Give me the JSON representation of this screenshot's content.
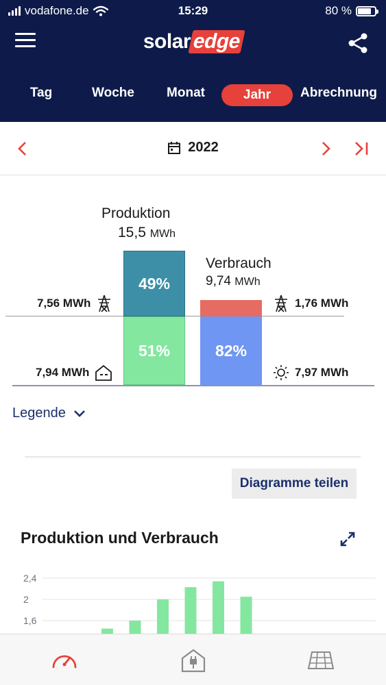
{
  "status_bar": {
    "carrier": "vodafone.de",
    "time": "15:29",
    "battery": "80 %",
    "battery_level": 0.8
  },
  "header": {
    "logo_part1": "solar",
    "logo_part2": "edge"
  },
  "tabs": [
    {
      "label": "Tag",
      "active": false
    },
    {
      "label": "Woche",
      "active": false
    },
    {
      "label": "Monat",
      "active": false
    },
    {
      "label": "Jahr",
      "active": true
    },
    {
      "label": "Abrechnung",
      "active": false
    }
  ],
  "date_nav": {
    "period": "2022"
  },
  "balance": {
    "production_label": "Produktion",
    "production_value": "15,5",
    "production_unit": "MWh",
    "consumption_label": "Verbrauch",
    "consumption_value": "9,74",
    "consumption_unit": "MWh",
    "export_percent": "49%",
    "self_consumption_percent": "51%",
    "solar_percent": "82%",
    "export_value": "7,56 MWh",
    "self_consumption_value": "7,94 MWh",
    "import_value": "1,76 MWh",
    "solar_value": "7,97 MWh",
    "colors": {
      "export": "#3c8fa6",
      "self_consumption": "#84e7a0",
      "import": "#e66b62",
      "solar": "#6f96f2"
    }
  },
  "legend_label": "Legende",
  "share_diagram_label": "Diagramme teilen",
  "production_consumption": {
    "title": "Produktion und Verbrauch"
  },
  "chart_data": {
    "type": "bar",
    "yticks": [
      "2,4",
      "2",
      "1,6"
    ],
    "ylim": [
      1.6,
      2.4
    ],
    "values": [
      1.45,
      1.6,
      2.0,
      2.23,
      2.34,
      2.05
    ],
    "color": "#84e7a0"
  },
  "bottom_nav": {
    "dashboard_icon": "speedometer-icon",
    "home_icon": "house-plug-icon",
    "layout_icon": "solar-panel-icon"
  }
}
